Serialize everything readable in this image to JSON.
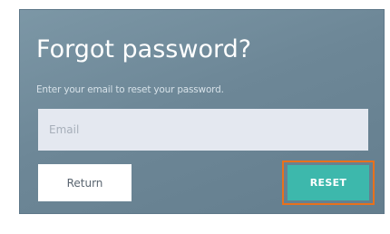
{
  "form": {
    "title": "Forgot password?",
    "subtitle": "Enter your email to reset your password.",
    "email": {
      "placeholder": "Email",
      "value": ""
    },
    "return_label": "Return",
    "reset_label": "RESET"
  },
  "colors": {
    "panel": "#6d8797",
    "input_background": "#e4e8f0",
    "reset_button": "#3db8ac",
    "highlight_border": "#e8711c",
    "return_button": "#ffffff"
  }
}
